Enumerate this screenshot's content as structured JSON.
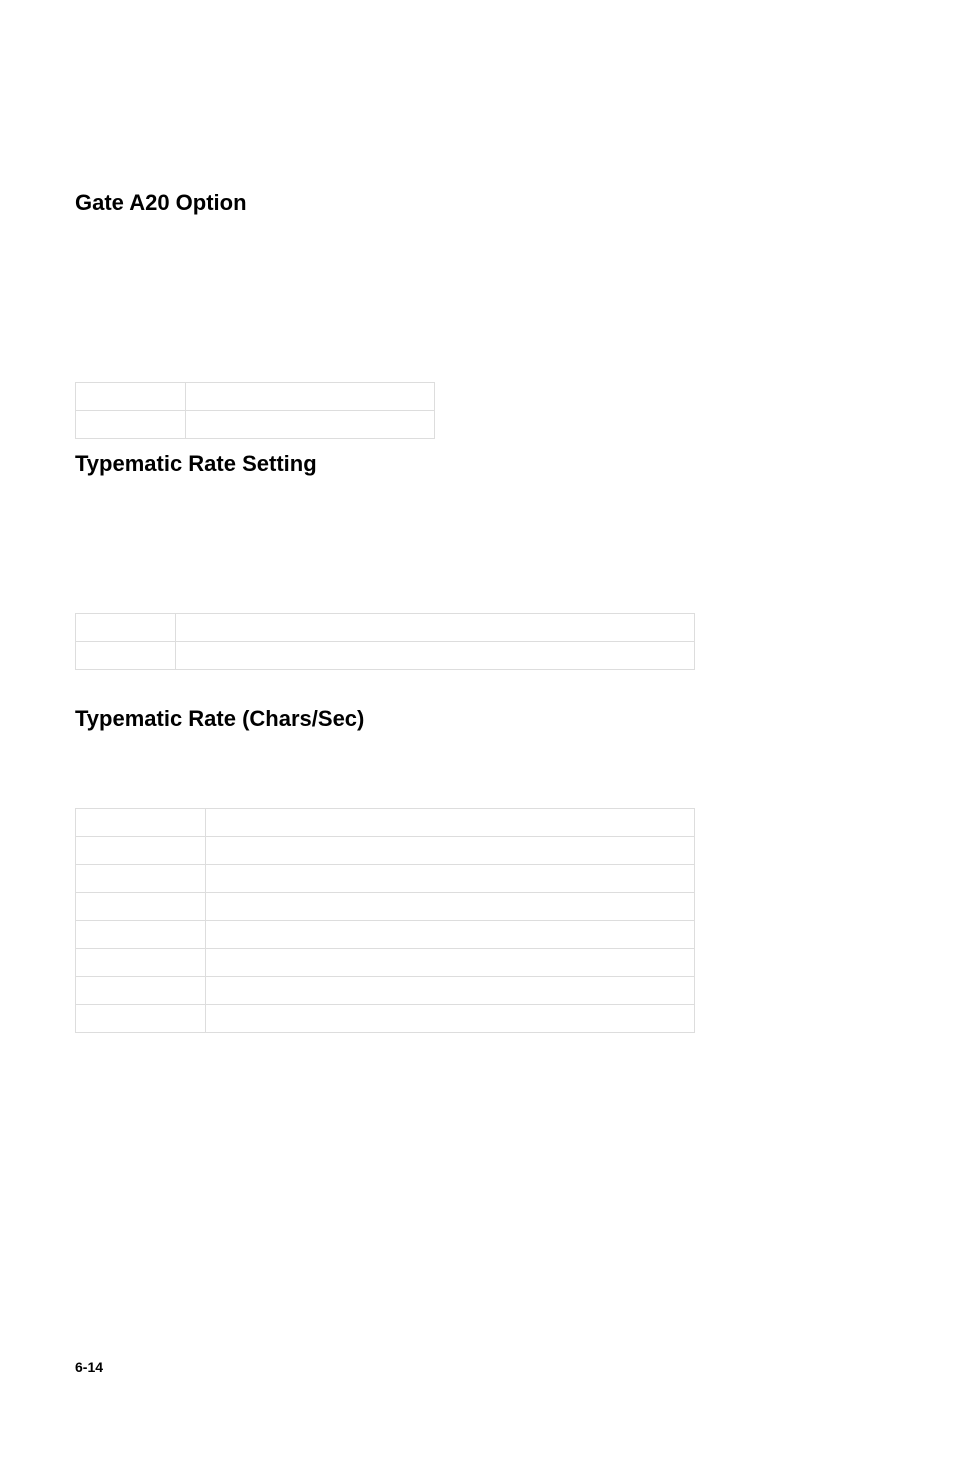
{
  "section1": {
    "heading": "Gate A20 Option",
    "rows": [
      {
        "c1": "",
        "c2": ""
      },
      {
        "c1": "",
        "c2": ""
      }
    ]
  },
  "section2": {
    "heading": "Typematic Rate Setting",
    "rows": [
      {
        "c1": "",
        "c2": ""
      },
      {
        "c1": "",
        "c2": ""
      }
    ]
  },
  "section3": {
    "heading": "Typematic Rate (Chars/Sec)",
    "rows": [
      {
        "c1": "",
        "c2": ""
      },
      {
        "c1": "",
        "c2": ""
      },
      {
        "c1": "",
        "c2": ""
      },
      {
        "c1": "",
        "c2": ""
      },
      {
        "c1": "",
        "c2": ""
      },
      {
        "c1": "",
        "c2": ""
      },
      {
        "c1": "",
        "c2": ""
      },
      {
        "c1": "",
        "c2": ""
      }
    ]
  },
  "page_number": "6-14"
}
